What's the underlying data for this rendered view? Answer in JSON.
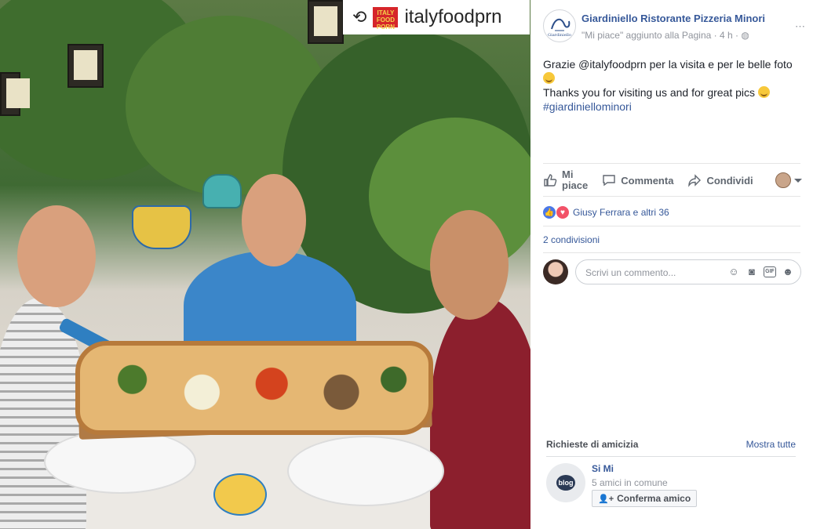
{
  "photo": {
    "repost_icon": "repost-icon",
    "brand_logo_text": "ITALY FOOD PORN",
    "handle": "italyfoodprn"
  },
  "post": {
    "page_name": "Giardiniello Ristorante Pizzeria Minori",
    "meta": "\"Mi piace\" aggiunto alla Pagina · 4 h ·",
    "text_line1": "Grazie @italyfoodprn per la visita e per le belle foto",
    "text_line2": "Thanks you for visiting us and for great pics",
    "hashtag": "#giardiniellominori"
  },
  "actions": {
    "like_label_1": "Mi",
    "like_label_2": "piace",
    "comment_label": "Commenta",
    "share_label": "Condividi"
  },
  "reactions": {
    "summary": "Giusy Ferrara e altri 36",
    "shares": "2 condivisioni"
  },
  "comment": {
    "placeholder": "Scrivi un commento...",
    "gif_label": "GIF"
  },
  "friend_requests": {
    "title": "Richieste di amicizia",
    "see_all": "Mostra tutte",
    "items": [
      {
        "name": "Si Mi",
        "mutual": "5 amici in comune",
        "confirm": "Conferma amico",
        "avatar_text": "blog"
      }
    ]
  },
  "colors": {
    "link": "#365899",
    "secondary_text": "#90949c",
    "like_blue": "#4a78e8",
    "love_red": "#f25268"
  }
}
